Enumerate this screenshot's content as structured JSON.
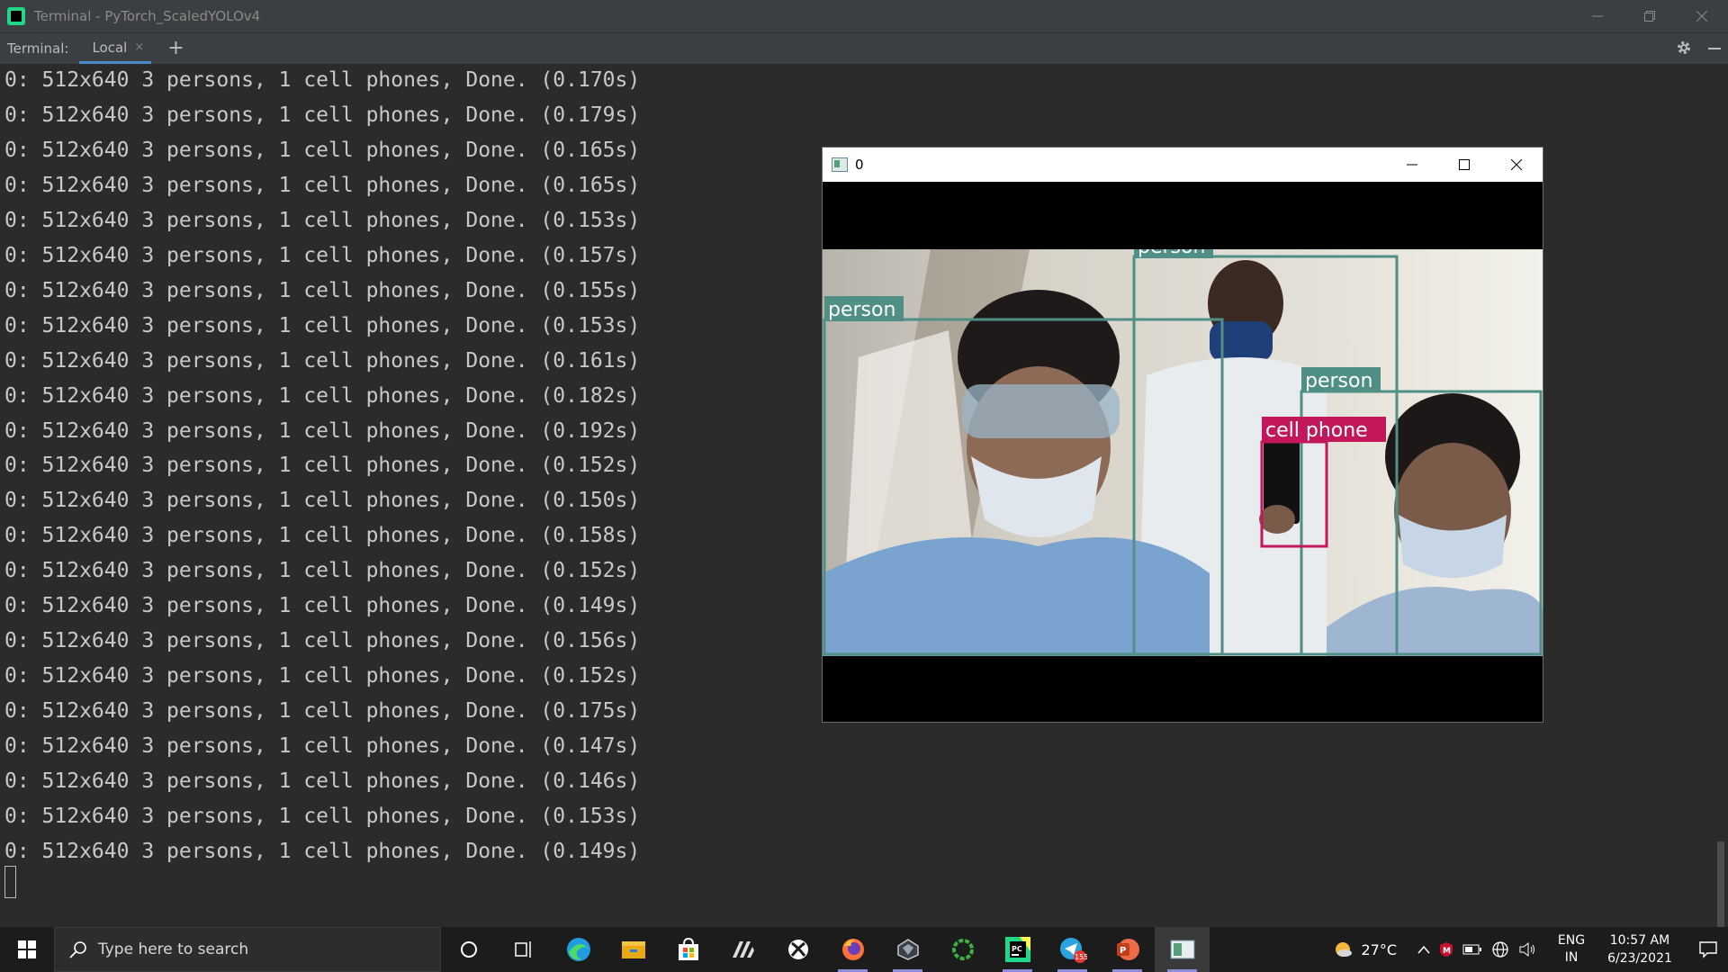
{
  "window": {
    "title": "Terminal - PyTorch_ScaledYOLOv4"
  },
  "terminal_tabs": {
    "prefix": "Terminal:",
    "active_tab": "Local",
    "close_glyph": "×",
    "add_glyph": "+"
  },
  "terminal": {
    "lines": [
      "0: 512x640 3 persons, 1 cell phones, Done. (0.170s)",
      "0: 512x640 3 persons, 1 cell phones, Done. (0.179s)",
      "0: 512x640 3 persons, 1 cell phones, Done. (0.165s)",
      "0: 512x640 3 persons, 1 cell phones, Done. (0.165s)",
      "0: 512x640 3 persons, 1 cell phones, Done. (0.153s)",
      "0: 512x640 3 persons, 1 cell phones, Done. (0.157s)",
      "0: 512x640 3 persons, 1 cell phones, Done. (0.155s)",
      "0: 512x640 3 persons, 1 cell phones, Done. (0.153s)",
      "0: 512x640 3 persons, 1 cell phones, Done. (0.161s)",
      "0: 512x640 3 persons, 1 cell phones, Done. (0.182s)",
      "0: 512x640 3 persons, 1 cell phones, Done. (0.192s)",
      "0: 512x640 3 persons, 1 cell phones, Done. (0.152s)",
      "0: 512x640 3 persons, 1 cell phones, Done. (0.150s)",
      "0: 512x640 3 persons, 1 cell phones, Done. (0.158s)",
      "0: 512x640 3 persons, 1 cell phones, Done. (0.152s)",
      "0: 512x640 3 persons, 1 cell phones, Done. (0.149s)",
      "0: 512x640 3 persons, 1 cell phones, Done. (0.156s)",
      "0: 512x640 3 persons, 1 cell phones, Done. (0.152s)",
      "0: 512x640 3 persons, 1 cell phones, Done. (0.175s)",
      "0: 512x640 3 persons, 1 cell phones, Done. (0.147s)",
      "0: 512x640 3 persons, 1 cell phones, Done. (0.146s)",
      "0: 512x640 3 persons, 1 cell phones, Done. (0.153s)",
      "0: 512x640 3 persons, 1 cell phones, Done. (0.149s)"
    ]
  },
  "cv_window": {
    "title": "0",
    "detections": [
      {
        "label": "person",
        "color": "#4f8f86"
      },
      {
        "label": "person",
        "color": "#4f8f86"
      },
      {
        "label": "person",
        "color": "#4f8f86"
      },
      {
        "label": "cell phone",
        "color": "#c2185b"
      }
    ]
  },
  "taskbar": {
    "search_placeholder": "Type here to search",
    "apps": [
      "cortana-icon",
      "task-view-icon",
      "edge-icon",
      "file-explorer-icon",
      "store-icon",
      "app-slashes-icon",
      "xbox-icon",
      "firefox-icon",
      "app-prism-icon",
      "app-ring-icon",
      "pycharm-icon",
      "telegram-icon",
      "powerpoint-icon",
      "opencv-window-icon"
    ],
    "telegram_badge": "155",
    "weather": "27°C",
    "language_line1": "ENG",
    "language_line2": "IN",
    "time": "10:57 AM",
    "date": "6/23/2021"
  },
  "colors": {
    "terminal_bg": "#2b2b2b",
    "terminal_text": "#c8c8c8",
    "person_box": "#4f8f86",
    "phone_box": "#c2185b",
    "tab_underline": "#4a88c7"
  }
}
